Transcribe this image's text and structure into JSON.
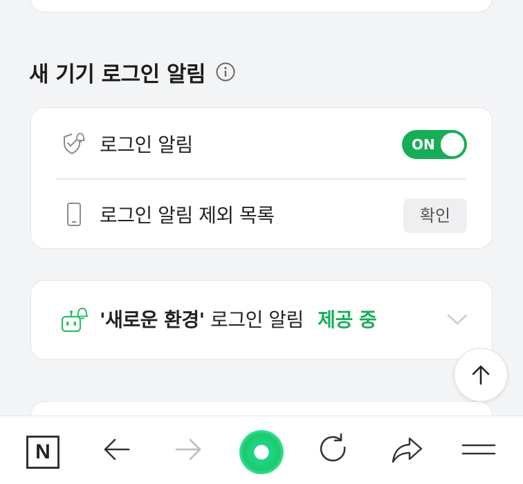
{
  "section": {
    "title": "새 기기 로그인 알림",
    "info_icon": "info-circle-icon"
  },
  "login_alert": {
    "icon": "shield-bell-icon",
    "label": "로그인 알림",
    "toggle": {
      "state": "ON",
      "on": true,
      "color": "#17ad57"
    }
  },
  "exclusion_list": {
    "icon": "smartphone-icon",
    "label": "로그인 알림 제외 목록",
    "button_label": "확인"
  },
  "new_environment": {
    "icon": "robot-bell-icon",
    "label_quoted": "'새로운 환경'",
    "label_rest": "로그인 알림",
    "status": "제공 중",
    "status_color": "#17ad57",
    "expand_icon": "chevron-down-icon"
  },
  "scroll_top_icon": "arrow-up-icon",
  "bottom_nav": {
    "items": [
      {
        "name": "naver-home",
        "icon": "n-logo-icon",
        "glyph": "N"
      },
      {
        "name": "back",
        "icon": "arrow-left-icon"
      },
      {
        "name": "forward",
        "icon": "arrow-right-icon",
        "disabled": true
      },
      {
        "name": "green-dot",
        "icon": "green-dot-icon"
      },
      {
        "name": "reload",
        "icon": "refresh-icon"
      },
      {
        "name": "share",
        "icon": "share-icon"
      },
      {
        "name": "menu",
        "icon": "hamburger-icon"
      }
    ]
  },
  "colors": {
    "background": "#f3f4f6",
    "card": "#ffffff",
    "accent_green": "#17ad57"
  }
}
